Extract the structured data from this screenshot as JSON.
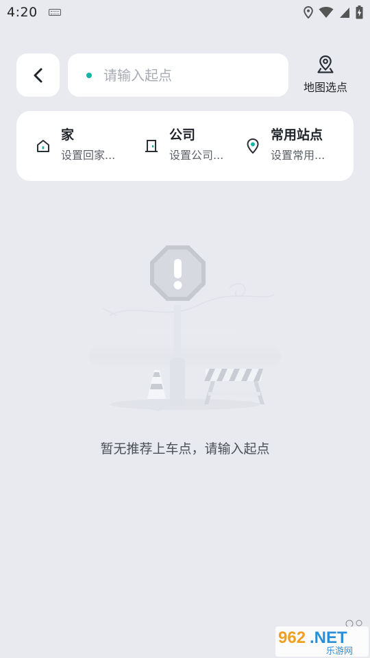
{
  "status_bar": {
    "time": "4:20"
  },
  "search": {
    "placeholder": "请输入起点",
    "dot_color": "#12b5a6"
  },
  "map_pick": {
    "label": "地图选点"
  },
  "shortcuts": [
    {
      "title": "家",
      "subtitle": "设置回家...",
      "icon": "home-icon"
    },
    {
      "title": "公司",
      "subtitle": "设置公司...",
      "icon": "office-door-icon"
    },
    {
      "title": "常用站点",
      "subtitle": "设置常用...",
      "icon": "location-pin-icon"
    }
  ],
  "empty_state": {
    "message": "暂无推荐上车点，请输入起点",
    "illustration": "warning-sign-roadblock"
  },
  "watermark": {
    "text_main": "962.NET",
    "text_sub": "乐游网"
  }
}
